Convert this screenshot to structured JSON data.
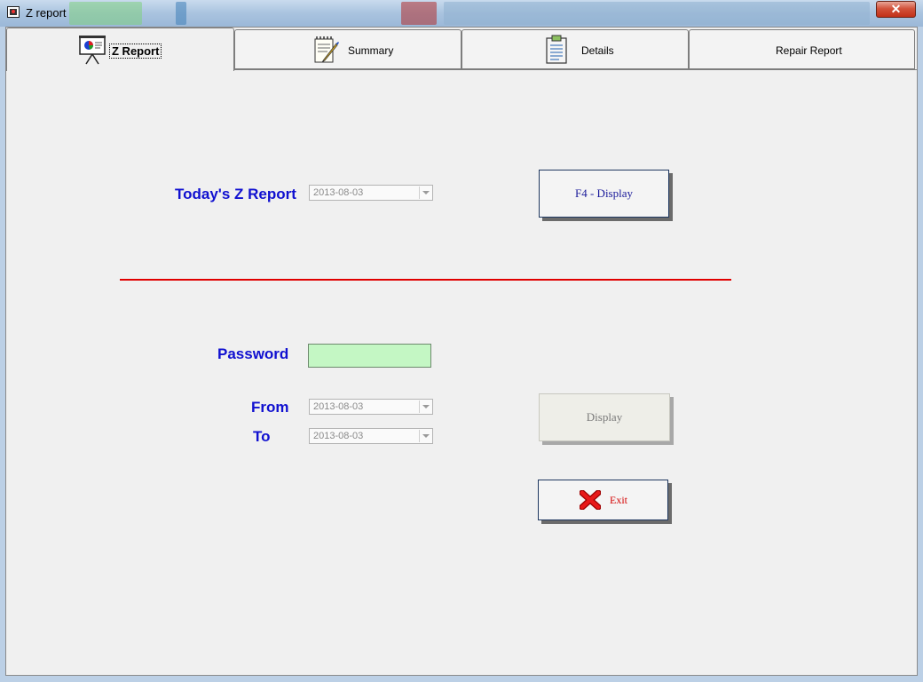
{
  "window": {
    "title": "Z report",
    "close_label": "✕"
  },
  "background_strip_colors": [
    "#7fd07f",
    "#3f7fb8",
    "#b03030",
    "#8fb0d0"
  ],
  "tabs": [
    {
      "label": "Z Report",
      "icon": "presentation-board-icon"
    },
    {
      "label": "Summary",
      "icon": "notepad-pen-icon"
    },
    {
      "label": "Details",
      "icon": "clipboard-icon"
    },
    {
      "label": "Repair Report",
      "icon": ""
    }
  ],
  "today": {
    "label": "Today's Z Report",
    "date": "2013-08-03",
    "button_label": "F4  -  Display"
  },
  "password": {
    "label": "Password",
    "value": ""
  },
  "range": {
    "from_label": "From",
    "from_date": "2013-08-03",
    "to_label": "To",
    "to_date": "2013-08-03",
    "display_label": "Display"
  },
  "exit": {
    "label": "Exit"
  },
  "colors": {
    "label_blue": "#1010d0",
    "divider_red": "#e00000",
    "password_bg": "#c4f7c4",
    "exit_red": "#d40000"
  }
}
